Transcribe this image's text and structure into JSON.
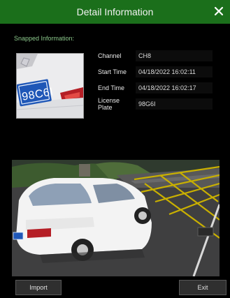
{
  "dialog": {
    "title": "Detail Information",
    "close_icon": "close-icon"
  },
  "snapped": {
    "label": "Snapped Information:",
    "plate_thumb_text": "98C6I"
  },
  "details": {
    "channel_label": "Channel",
    "channel_value": "CH8",
    "start_label": "Start Time",
    "start_value": "04/18/2022 16:02:11",
    "end_label": "End Time",
    "end_value": "04/18/2022 16:02:17",
    "plate_label": "License Plate",
    "plate_value": "98G6I"
  },
  "buttons": {
    "import": "Import",
    "exit": "Exit"
  },
  "colors": {
    "title_bar": "#1b6f1b",
    "accent": "#8cc98c",
    "plate_blue": "#1f57b7"
  }
}
